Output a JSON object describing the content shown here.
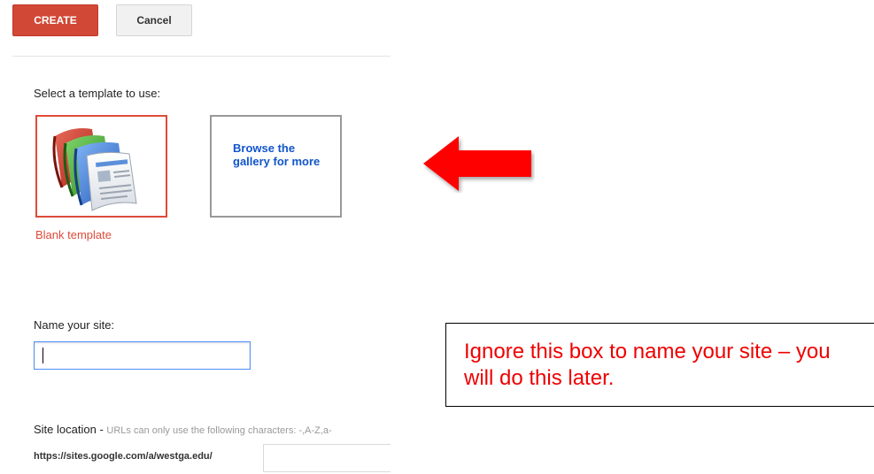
{
  "toolbar": {
    "create_label": "CREATE",
    "cancel_label": "Cancel"
  },
  "template_section": {
    "heading": "Select a template to use:",
    "blank_template_label": "Blank template",
    "browse_gallery_label": "Browse the gallery for more"
  },
  "name_section": {
    "label": "Name your site:",
    "value": ""
  },
  "location_section": {
    "label": "Site location",
    "separator": " - ",
    "hint": "URLs can only use the following characters: -,A-Z,a-",
    "url_prefix": "https://sites.google.com/a/westga.edu/",
    "value": ""
  },
  "annotation": {
    "callout_text": "Ignore this box to name your site – you will do this later.",
    "arrow_color": "#ff0000"
  },
  "colors": {
    "create_button": "#d14836",
    "selected_border": "#dd4b39",
    "link_blue": "#1155cc",
    "focus_blue": "#4d90fe",
    "callout_text": "#ee0000"
  }
}
